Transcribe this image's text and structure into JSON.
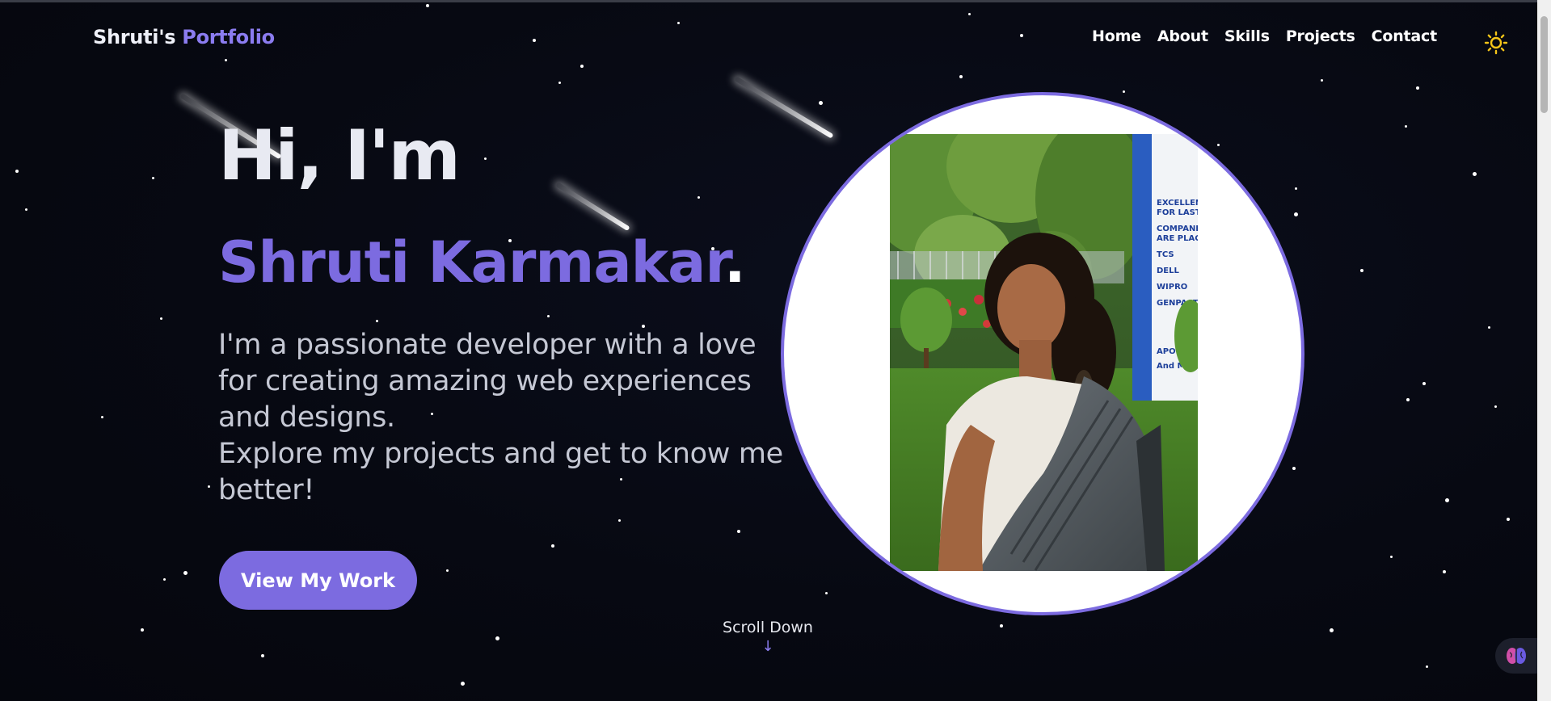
{
  "nav": {
    "brand_name": "Shruti's",
    "brand_accent": "Portfolio",
    "links": [
      "Home",
      "About",
      "Skills",
      "Projects",
      "Contact"
    ],
    "theme_toggle_icon": "sun-icon"
  },
  "hero": {
    "greeting": "Hi, I'm",
    "name": "Shruti Karmakar",
    "name_suffix": ".",
    "description_line1": "I'm a passionate developer with a love for creating amazing web experiences and designs.",
    "description_line2": "Explore my projects and get to know me better!",
    "cta_label": "View My Work",
    "scroll_label": "Scroll Down",
    "scroll_icon": "arrow-down-icon"
  },
  "photo": {
    "sign_text": [
      "TCS",
      "DELL",
      "WIPRO",
      "GENPACT",
      "APOLLO",
      "And Ma"
    ],
    "sign_header": [
      "EXCELLENT P",
      "FOR LAST TW",
      "COMPANIES W",
      "ARE PLACED:-"
    ]
  },
  "widget": {
    "icon": "brain-icon"
  },
  "colors": {
    "accent": "#7c6be0",
    "background": "#060812",
    "text": "#e8eaf2",
    "sun": "#f5c518"
  }
}
